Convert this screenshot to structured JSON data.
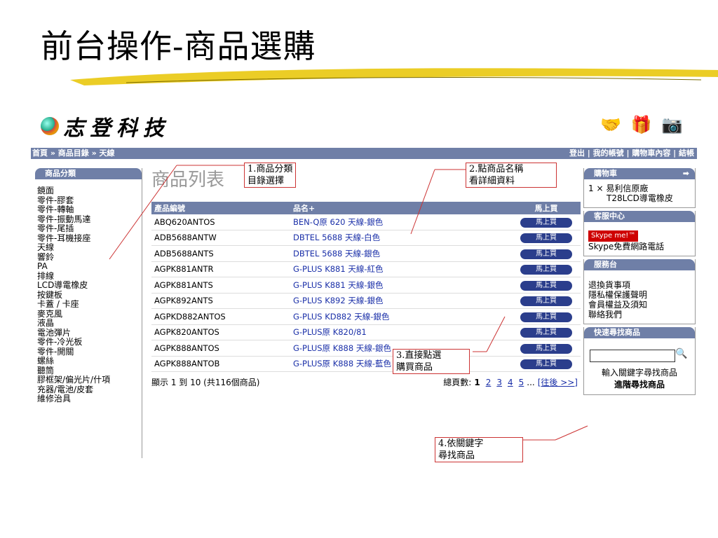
{
  "slide_title": "前台操作-商品選購",
  "logo_text": "志登科技",
  "icons": [
    "handshake-icon",
    "gift-icon",
    "camera-icon"
  ],
  "nav": {
    "crumb": "首頁 » 商品目錄 » 天線",
    "links": "登出 | 我的帳號 | 購物車內容 | 結帳"
  },
  "left": {
    "header": "商品分類",
    "categories": [
      "鏡面",
      "零件-膠套",
      "零件-轉軸",
      "零件-振動馬達",
      "零件-尾插",
      "零件-耳機接座",
      "天線",
      "響鈴",
      "PA",
      "排線",
      "LCD導電橡皮",
      "按鍵板",
      "卡蓋 / 卡座",
      "麥克風",
      "液晶",
      "電池彈片",
      "零件-冷光板",
      "零件-開關",
      "螺絲",
      "聽筒",
      "膠框架/偏光片/什項",
      "充器/電池/皮套",
      "維修治具"
    ]
  },
  "main": {
    "heading": "商品列表",
    "cols": {
      "code": "產品編號",
      "name": "品名+",
      "buy": "馬上買"
    },
    "rows": [
      {
        "code": "ABQ620ANTOS",
        "name": "BEN-Q原 620 天線-銀色",
        "buy": "馬上買"
      },
      {
        "code": "ADB5688ANTW",
        "name": "DBTEL 5688 天線-白色",
        "buy": "馬上買"
      },
      {
        "code": "ADB5688ANTS",
        "name": "DBTEL 5688 天線-銀色",
        "buy": "馬上買"
      },
      {
        "code": "AGPK881ANTR",
        "name": "G-PLUS K881 天線-紅色",
        "buy": "馬上買"
      },
      {
        "code": "AGPK881ANTS",
        "name": "G-PLUS K881 天線-銀色",
        "buy": "馬上買"
      },
      {
        "code": "AGPK892ANTS",
        "name": "G-PLUS K892 天線-銀色",
        "buy": "馬上買"
      },
      {
        "code": "AGPKD882ANTOS",
        "name": "G-PLUS KD882 天線-銀色",
        "buy": "馬上買"
      },
      {
        "code": "AGPK820ANTOS",
        "name": "G-PLUS原 K820/81",
        "buy": "馬上買"
      },
      {
        "code": "AGPK888ANTOS",
        "name": "G-PLUS原 K888 天線-銀色",
        "buy": "馬上買"
      },
      {
        "code": "AGPK888ANTOB",
        "name": "G-PLUS原 K888 天線-藍色",
        "buy": "馬上買"
      }
    ],
    "showing": "顯示 1 到 10 (共116個商品)",
    "pages_label": "總頁數:",
    "pages": [
      "1",
      "2",
      "3",
      "4",
      "5"
    ],
    "ellipsis": "...",
    "next": "[往後 >>]"
  },
  "right": {
    "cart": {
      "header": "購物車",
      "item_line1": "1 × 易利信原廠",
      "item_line2": "T28LCD導電橡皮"
    },
    "service": {
      "header": "客服中心",
      "skype_btn": "Skype me!™",
      "skype_text": "Skype免費網路電話"
    },
    "info": {
      "header": "服務台",
      "links": [
        "退換貨事項",
        "隱私權保護聲明",
        "會員權益及須知",
        "聯絡我們"
      ]
    },
    "search": {
      "header": "快速尋找商品",
      "hint": "輸入關鍵字尋找商品",
      "advanced": "進階尋找商品"
    }
  },
  "notes": {
    "n1": [
      "1.商品分類",
      "目錄選擇"
    ],
    "n2": [
      "2.點商品名稱",
      "看詳細資料"
    ],
    "n3": [
      "3.直接點選",
      "購買商品"
    ],
    "n4": [
      "4.依關鍵字",
      "尋找商品"
    ]
  }
}
